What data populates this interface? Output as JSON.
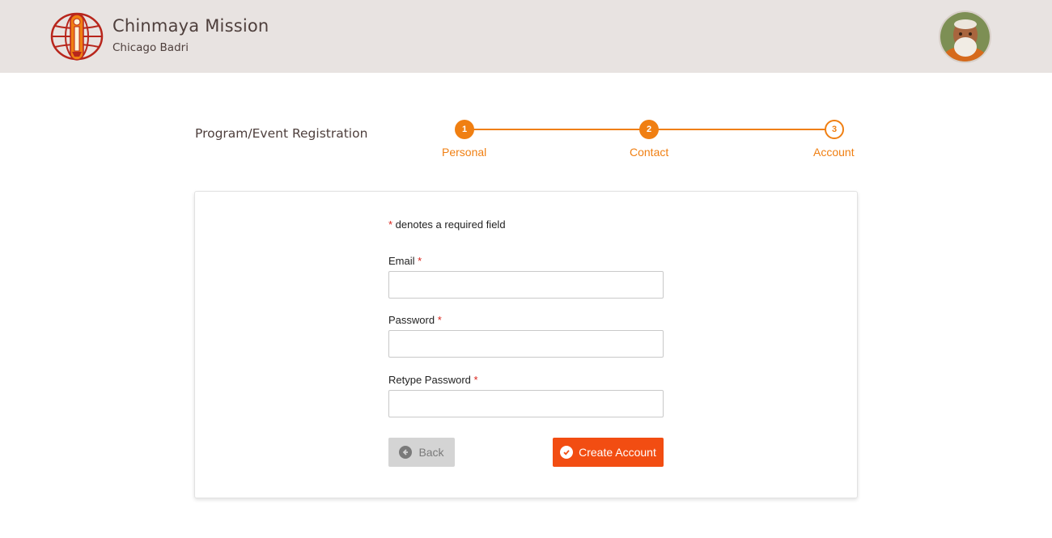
{
  "header": {
    "org_name": "Chinmaya Mission",
    "branch": "Chicago Badri"
  },
  "registration": {
    "title": "Program/Event Registration",
    "steps": [
      {
        "number": "1",
        "label": "Personal",
        "state": "done"
      },
      {
        "number": "2",
        "label": "Contact",
        "state": "done"
      },
      {
        "number": "3",
        "label": "Account",
        "state": "current"
      }
    ]
  },
  "form": {
    "required_star": "*",
    "required_note": " denotes a required field",
    "fields": [
      {
        "label": "Email",
        "value": ""
      },
      {
        "label": "Password",
        "value": ""
      },
      {
        "label": "Retype Password",
        "value": ""
      }
    ],
    "back_label": "Back",
    "submit_label": "Create Account"
  },
  "colors": {
    "accent": "#f07f12",
    "primary_button": "#f24d12",
    "required": "#d9241b",
    "header_bg": "#e8e3e1"
  },
  "icons": {
    "back": "arrow-left-circle-icon",
    "submit": "check-circle-icon"
  }
}
